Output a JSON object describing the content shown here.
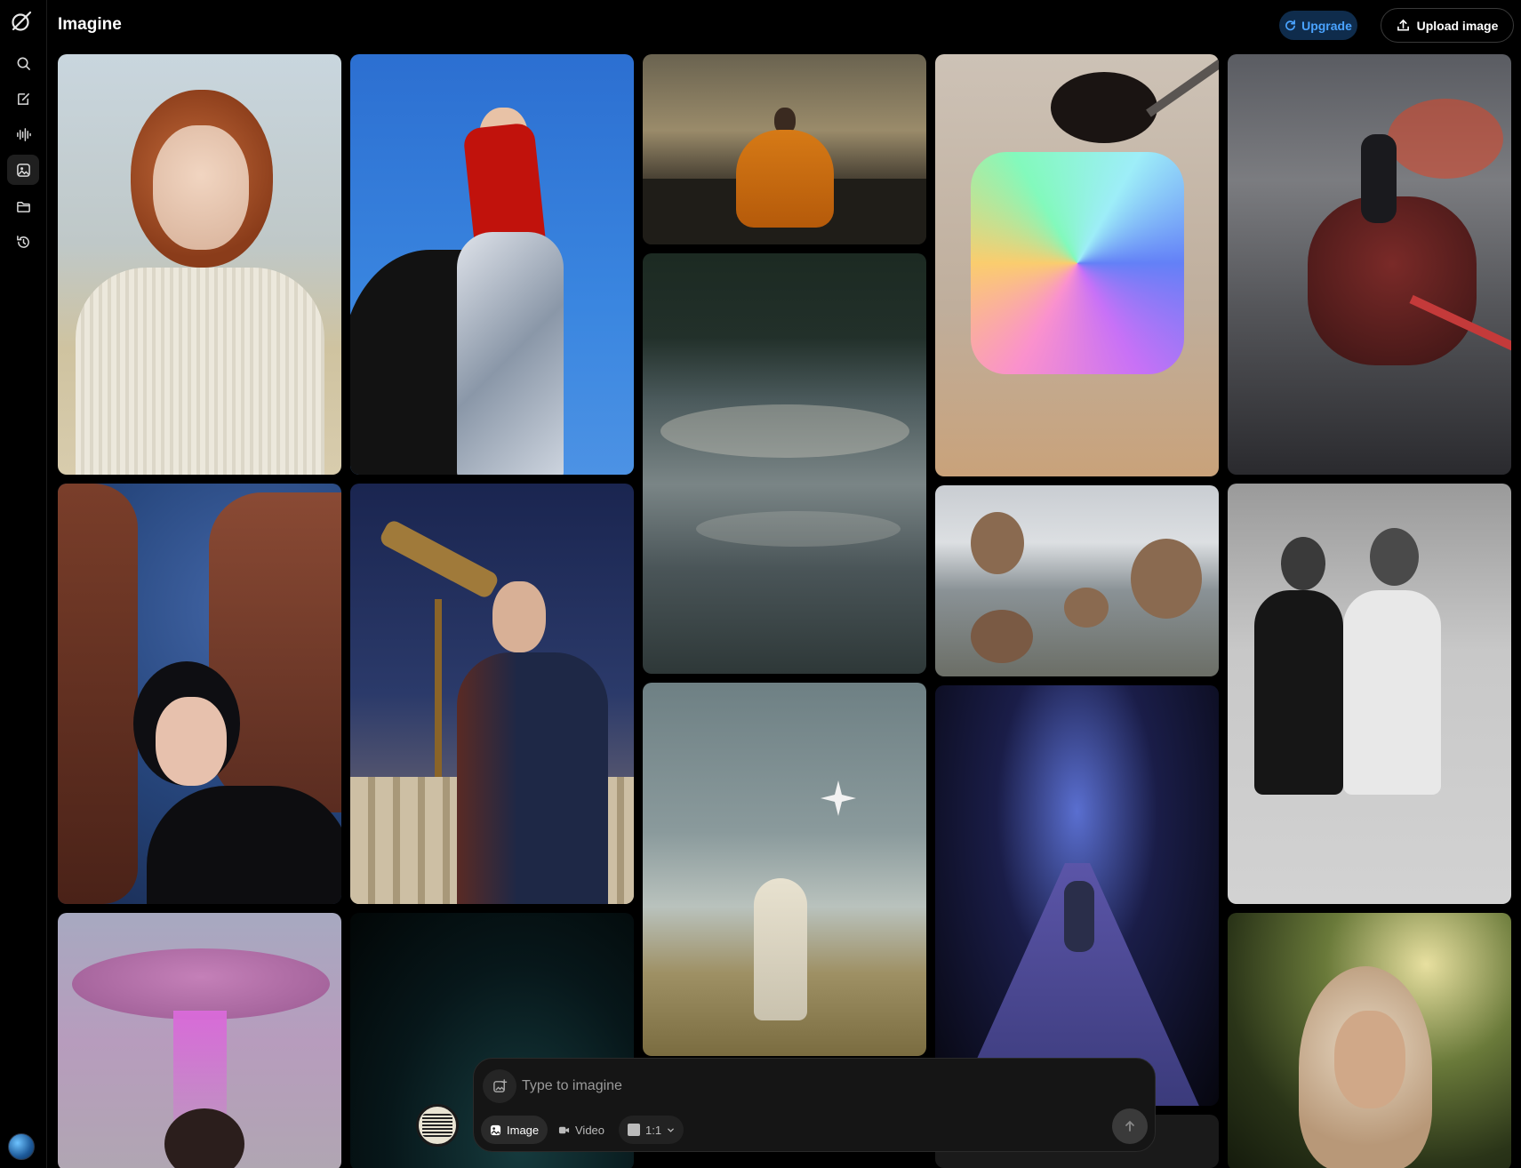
{
  "app": {
    "title": "Imagine"
  },
  "header": {
    "upgrade_label": "Upgrade",
    "upload_label": "Upload image"
  },
  "sidebar": {
    "items": [
      {
        "name": "search",
        "icon": "search-icon"
      },
      {
        "name": "edit",
        "icon": "edit-icon"
      },
      {
        "name": "voice",
        "icon": "waveform-icon"
      },
      {
        "name": "imagine",
        "icon": "imagine-icon",
        "active": true
      },
      {
        "name": "files",
        "icon": "folder-icon"
      },
      {
        "name": "history",
        "icon": "history-icon"
      }
    ]
  },
  "gallery": {
    "items": [
      {
        "name": "redhead-portrait"
      },
      {
        "name": "woman-red-scarf-horse"
      },
      {
        "name": "monk-meditating"
      },
      {
        "name": "prismatic-ice-cube"
      },
      {
        "name": "dragon-rider"
      },
      {
        "name": "rushing-river"
      },
      {
        "name": "woman-starry-rocks"
      },
      {
        "name": "astronomer-telescope"
      },
      {
        "name": "snow-monkeys-hot-spring"
      },
      {
        "name": "roller-skating-women"
      },
      {
        "name": "woman-reaching-star"
      },
      {
        "name": "cyclist-space-road"
      },
      {
        "name": "ufo-beam"
      },
      {
        "name": "dark-vortex"
      },
      {
        "name": "elf-woman-forest"
      },
      {
        "name": "partial-tile"
      }
    ]
  },
  "prompt": {
    "placeholder": "Type to imagine",
    "modes": [
      {
        "label": "Image",
        "active": true
      },
      {
        "label": "Video",
        "active": false
      }
    ],
    "aspect_ratio": "1:1"
  },
  "colors": {
    "accent": "#4aa3ff",
    "upgrade_bg": "#0f2c4c",
    "background": "#000000"
  }
}
